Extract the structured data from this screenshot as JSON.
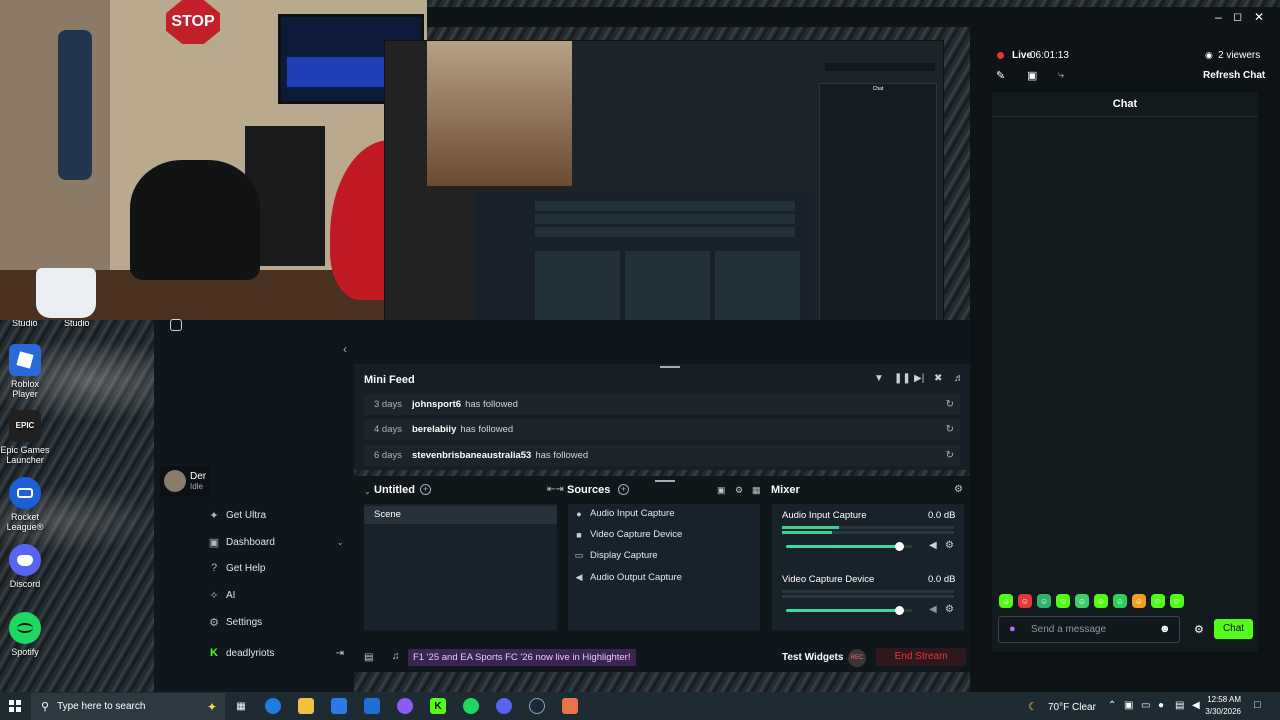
{
  "desktop": {
    "studio_labels": [
      "Studio",
      "Studio"
    ],
    "icons": [
      {
        "label": "Roblox Player"
      },
      {
        "label": "Epic Games Launcher",
        "glyph": "EPIC"
      },
      {
        "label": "Rocket League®"
      },
      {
        "label": "Discord"
      },
      {
        "label": "Spotify"
      }
    ]
  },
  "webcam": {
    "sign_text": "STOP"
  },
  "preview": {
    "chat_label": "Chat"
  },
  "obs": {
    "user": {
      "name": "Der",
      "status": "Idle"
    },
    "sidebar": [
      {
        "label": "Get Ultra",
        "icon": "ultra-icon"
      },
      {
        "label": "Dashboard",
        "icon": "dashboard-icon"
      },
      {
        "label": "Get Help",
        "icon": "help-icon"
      },
      {
        "label": "AI",
        "icon": "ai-icon"
      },
      {
        "label": "Settings",
        "icon": "gear-icon"
      },
      {
        "label": "deadlyriots",
        "icon": "kick-icon"
      }
    ],
    "mini_feed": {
      "title": "Mini Feed",
      "rows": [
        {
          "time": "3 days",
          "user": "johnsport6",
          "text": "has followed"
        },
        {
          "time": "4 days",
          "user": "berelabiiy",
          "text": "has followed"
        },
        {
          "time": "6 days",
          "user": "stevenbrisbaneaustralia53",
          "text": "has followed"
        }
      ]
    },
    "scenes": {
      "title": "Untitled",
      "items": [
        "Scene"
      ]
    },
    "sources": {
      "title": "Sources",
      "items": [
        {
          "label": "Audio Input Capture",
          "icon": "mic-icon"
        },
        {
          "label": "Video Capture Device",
          "icon": "camera-icon"
        },
        {
          "label": "Display Capture",
          "icon": "monitor-icon"
        },
        {
          "label": "Audio Output Capture",
          "icon": "speaker-icon"
        }
      ]
    },
    "mixer": {
      "title": "Mixer",
      "channels": [
        {
          "name": "Audio Input Capture",
          "db": "0.0 dB",
          "level": 0.9
        },
        {
          "name": "Video Capture Device",
          "db": "0.0 dB",
          "level": 0.9
        }
      ]
    },
    "footer": {
      "banner": "F1 '25 and EA Sports FC '26 now live in Highlighter!",
      "test_widgets": "Test Widgets",
      "rec": "REC",
      "end_stream": "End Stream"
    }
  },
  "chat_panel": {
    "live_label": "Live",
    "live_time": "06:01:13",
    "viewers": "2 viewers",
    "refresh": "Refresh Chat",
    "title": "Chat",
    "placeholder": "Send a message",
    "chat_button": "Chat"
  },
  "taskbar": {
    "search_placeholder": "Type here to search",
    "weather": "70°F Clear",
    "time": "12:58 AM",
    "date": "3/30/2026"
  },
  "colors": {
    "accent_green": "#53fc18",
    "live_red": "#e53935",
    "end_stream": "#e8323c",
    "mixer_green": "#46d6a4"
  }
}
